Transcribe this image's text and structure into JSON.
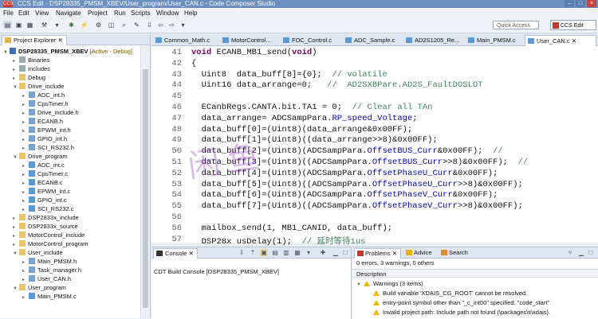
{
  "window": {
    "title": "CCS Edit - DSP28335_PMSM_XBEV/User_program/User_CAN.c - Code Composer Studio",
    "app_icon": "CCS"
  },
  "menu": [
    "File",
    "Edit",
    "View",
    "Navigate",
    "Project",
    "Run",
    "Scripts",
    "Window",
    "Help"
  ],
  "toolbar": {
    "quick_access": "Quick Access",
    "perspective": "CCS Edit"
  },
  "project_explorer": {
    "tab": "Project Explorer",
    "items": [
      {
        "label": "DSP28335_PMSM_XBEV",
        "status": "[Active - Debug]"
      },
      {
        "label": "Binaries"
      },
      {
        "label": "Includes"
      },
      {
        "label": "Debug"
      },
      {
        "label": "Drive_include"
      },
      {
        "label": "ADC_int.h"
      },
      {
        "label": "CpuTimer.h"
      },
      {
        "label": "Drive_include.h"
      },
      {
        "label": "ECANB.h"
      },
      {
        "label": "EPWM_int.h"
      },
      {
        "label": "GPIO_int.h"
      },
      {
        "label": "SCI_RS232.h"
      },
      {
        "label": "Drive_program"
      },
      {
        "label": "ADC_int.c"
      },
      {
        "label": "CpuTimer.c"
      },
      {
        "label": "ECANB.c"
      },
      {
        "label": "EPWM_int.c"
      },
      {
        "label": "GPIO_int.c"
      },
      {
        "label": "SCI_RS232.c"
      },
      {
        "label": "DSP2833x_include"
      },
      {
        "label": "DSP2833x_source"
      },
      {
        "label": "MotorControl_include"
      },
      {
        "label": "MotorControl_program"
      },
      {
        "label": "User_include"
      },
      {
        "label": "Main_PMSM.h"
      },
      {
        "label": "Task_manager.h"
      },
      {
        "label": "User_CAN.h"
      },
      {
        "label": "User_program"
      },
      {
        "label": "Main_PMSM.c"
      }
    ]
  },
  "editor": {
    "tabs": [
      "Common_Math.c",
      "MotorControl...",
      "FOC_Control.c",
      "ADC_Sample.c",
      "AD2S1205_Re...",
      "Main_PMSM.c",
      "User_CAN.c"
    ],
    "lines": [
      {
        "n": "41",
        "parts": [
          {
            "t": "void ",
            "c": "kw"
          },
          {
            "t": "ECANB_MB1_send(",
            "c": "fn"
          },
          {
            "t": "void",
            "c": "kw"
          },
          {
            "t": ")",
            "c": "fn"
          }
        ]
      },
      {
        "n": "42",
        "parts": [
          {
            "t": "{",
            "c": ""
          }
        ]
      },
      {
        "n": "43",
        "parts": [
          {
            "t": "  Uint8  data_buff[8]={0};  ",
            "c": ""
          },
          {
            "t": "// volatile",
            "c": "cm"
          }
        ]
      },
      {
        "n": "44",
        "parts": [
          {
            "t": "  Uint16 data_arrange=0;   ",
            "c": ""
          },
          {
            "t": "//  AD2SXBPare.AD2S_FaultDOSLOT",
            "c": "cm"
          }
        ]
      },
      {
        "n": "45",
        "parts": [
          {
            "t": "",
            "c": ""
          }
        ]
      },
      {
        "n": "46",
        "parts": [
          {
            "t": "  ECanbRegs.CANTA.bit.TA1 = 0;  ",
            "c": ""
          },
          {
            "t": "// Clear all TAn",
            "c": "cm"
          }
        ]
      },
      {
        "n": "47",
        "parts": [
          {
            "t": "  data_arrange= ADCSampPara.",
            "c": ""
          },
          {
            "t": "RP_speed_Voltage",
            "c": "bl"
          },
          {
            "t": ";",
            "c": ""
          }
        ]
      },
      {
        "n": "48",
        "parts": [
          {
            "t": "  data_buff[0]=(Uint8)(data_arrange&0x00FF);",
            "c": ""
          }
        ]
      },
      {
        "n": "49",
        "parts": [
          {
            "t": "  data_buff[1]=(Uint8)((data_arrange>>8)&0x00FF);",
            "c": ""
          }
        ]
      },
      {
        "n": "50",
        "parts": [
          {
            "t": "  data_buff[2]=(Uint8)(ADCSampPara.",
            "c": ""
          },
          {
            "t": "OffsetBUS_Curr",
            "c": "bl"
          },
          {
            "t": "&0x00FF);  ",
            "c": ""
          },
          {
            "t": "//",
            "c": "cm"
          }
        ]
      },
      {
        "n": "51",
        "parts": [
          {
            "t": "  data_buff[3]=(Uint8)((ADCSampPara.",
            "c": ""
          },
          {
            "t": "OffsetBUS_Curr",
            "c": "bl"
          },
          {
            "t": ">>8)&0x00FF);  ",
            "c": ""
          },
          {
            "t": "//",
            "c": "cm"
          }
        ]
      },
      {
        "n": "52",
        "parts": [
          {
            "t": "  data_buff[4]=(Uint8)(ADCSampPara.",
            "c": ""
          },
          {
            "t": "OffsetPhaseU_Curr",
            "c": "bl"
          },
          {
            "t": "&0x00FF);",
            "c": ""
          }
        ]
      },
      {
        "n": "53",
        "parts": [
          {
            "t": "  data_buff[5]=(Uint8)((ADCSampPara.",
            "c": ""
          },
          {
            "t": "OffsetPhaseU_Curr",
            "c": "bl"
          },
          {
            "t": ">>8)&0x00FF);",
            "c": ""
          }
        ]
      },
      {
        "n": "54",
        "parts": [
          {
            "t": "  data_buff[6]=(Uint8)(ADCSampPara.",
            "c": ""
          },
          {
            "t": "OffsetPhaseV_Curr",
            "c": "bl"
          },
          {
            "t": "&0x00FF);",
            "c": ""
          }
        ]
      },
      {
        "n": "55",
        "parts": [
          {
            "t": "  data_buff[7]=(Uint8)((ADCSampPara.",
            "c": ""
          },
          {
            "t": "OffsetPhaseV_Curr",
            "c": "bl"
          },
          {
            "t": ">>8)&0x00FF);",
            "c": ""
          }
        ]
      },
      {
        "n": "56",
        "parts": [
          {
            "t": "",
            "c": ""
          }
        ]
      },
      {
        "n": "56",
        "parts": [
          {
            "t": "  mailbox_send(1, MB1_CANID, data_buff);",
            "c": ""
          }
        ]
      },
      {
        "n": "57",
        "parts": [
          {
            "t": "  DSP28x usDelay(1);  ",
            "c": ""
          },
          {
            "t": "// 延时等待1us",
            "c": "cm"
          }
        ]
      }
    ],
    "watermark": "闲鱼"
  },
  "console": {
    "tab": "Console",
    "label": "CDT Build Console [DSP28335_PMSM_XBEV]"
  },
  "problems": {
    "tabs": [
      "Problems",
      "Advice",
      "Search"
    ],
    "summary": "0 errors, 3 warnings, 0 others",
    "column": "Description",
    "group": "Warnings (3 items)",
    "warnings": [
      "Build variable 'XDAIS_CG_ROOT' cannot be resolved.",
      "entry-point symbol other than \"_c_int00\" specified:  \"code_start\"",
      "Invalid project path: Include path not found (\\packages\\ti\\xdais)."
    ]
  }
}
